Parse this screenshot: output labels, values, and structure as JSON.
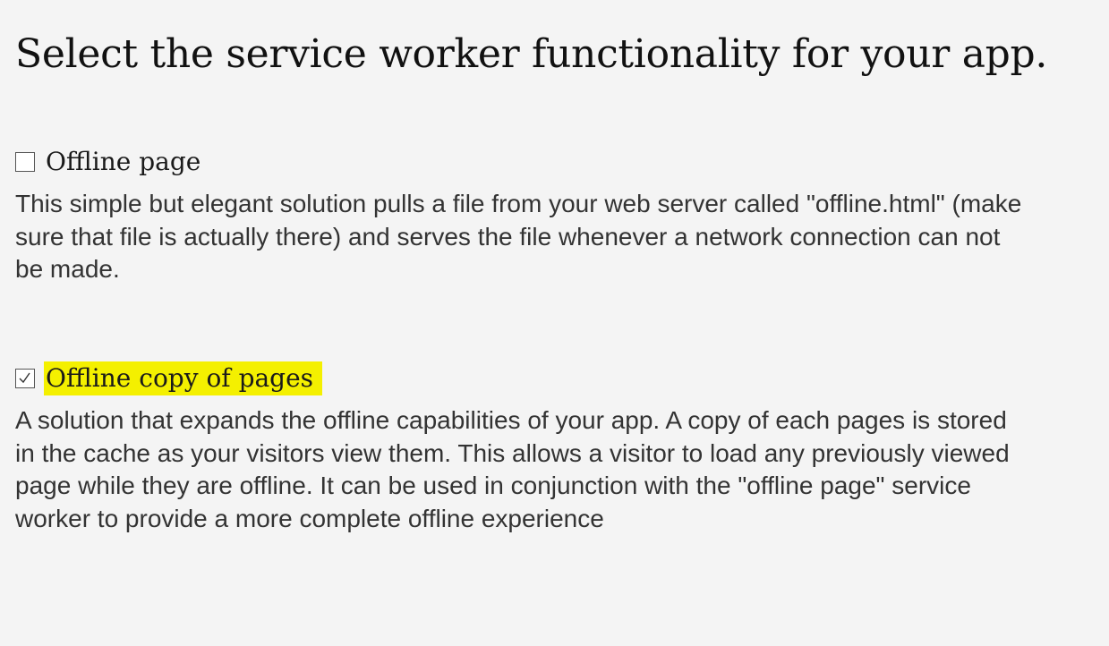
{
  "page": {
    "title": "Select the service worker functionality for your app."
  },
  "options": [
    {
      "label": "Offline page",
      "checked": false,
      "description": "This simple but elegant solution pulls a file from your web server called \"offline.html\" (make sure that file is actually there) and serves the file whenever a network connection can not be made."
    },
    {
      "label": "Offline copy of pages",
      "checked": true,
      "highlighted": true,
      "description": "A solution that expands the offline capabilities of your app. A copy of each pages is stored in the cache as your visitors view them. This allows a visitor to load any previously viewed page while they are offline. It can be used in conjunction with the \"offline page\" service worker to provide a more complete offline experience"
    }
  ],
  "colors": {
    "background": "#f4f4f4",
    "highlight": "#f4f000",
    "text": "#333333"
  },
  "icons": {
    "checkmark": "check-icon"
  }
}
